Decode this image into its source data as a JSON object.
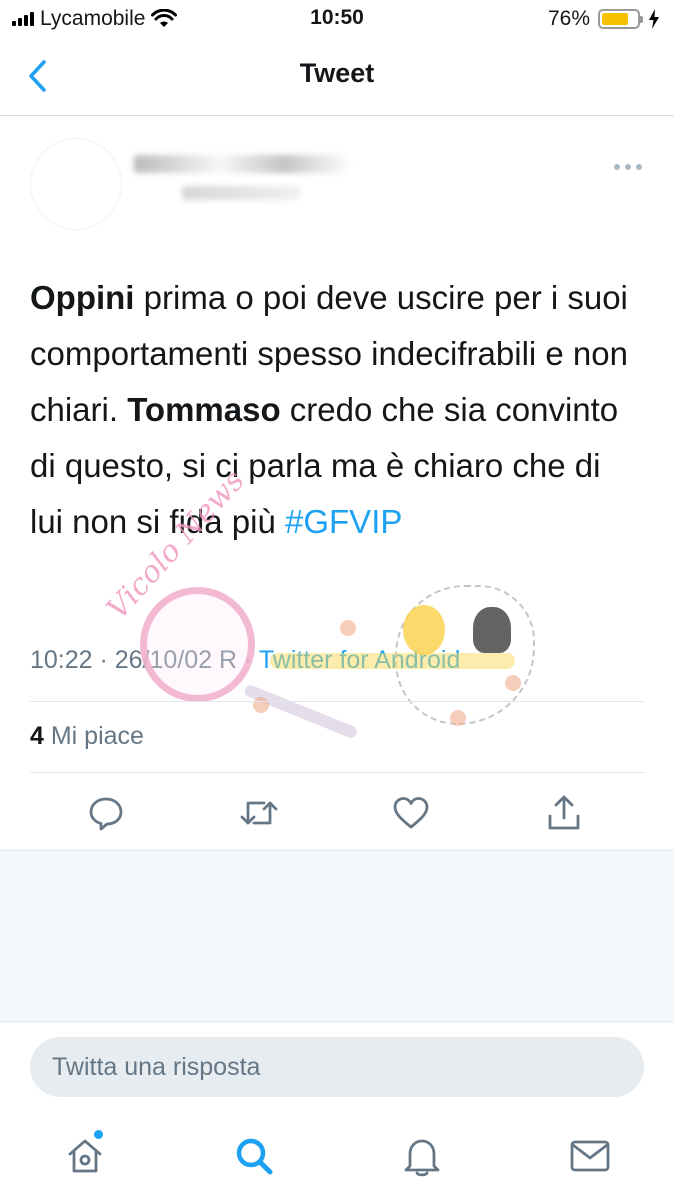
{
  "status_bar": {
    "carrier": "Lycamobile",
    "time": "10:50",
    "battery": "76%",
    "battery_level": 0.76
  },
  "header": {
    "title": "Tweet"
  },
  "tweet": {
    "text_parts": [
      {
        "text": "Oppini",
        "bold": true
      },
      {
        "text": " prima o poi deve uscire per i suoi comportamenti spesso indecifrabili e non chiari. "
      },
      {
        "text": "Tommaso",
        "bold": true
      },
      {
        "text": " credo che  sia convinto di questo, si ci parla ma è chiaro che di lui non si fida più "
      },
      {
        "text": "#GFVIP",
        "hashtag": true
      }
    ],
    "timestamp": "10:22 · 26/10/02 R",
    "source": "Twitter for Android",
    "likes_count": "4",
    "likes_label": "Mi piace"
  },
  "reply": {
    "placeholder": "Twitta una risposta"
  },
  "icons": {
    "back": "chevron-left-icon",
    "more": "more-dots-icon",
    "reply": "reply-icon",
    "retweet": "retweet-icon",
    "like": "heart-icon",
    "share": "share-icon",
    "home": "home-icon",
    "search": "search-icon",
    "notifications": "bell-icon",
    "messages": "mail-icon"
  },
  "colors": {
    "accent": "#1da1f2",
    "text": "#14171a",
    "secondary_text": "#657786",
    "battery": "#f7c300"
  },
  "watermark": {
    "text": "Vicolo News"
  }
}
